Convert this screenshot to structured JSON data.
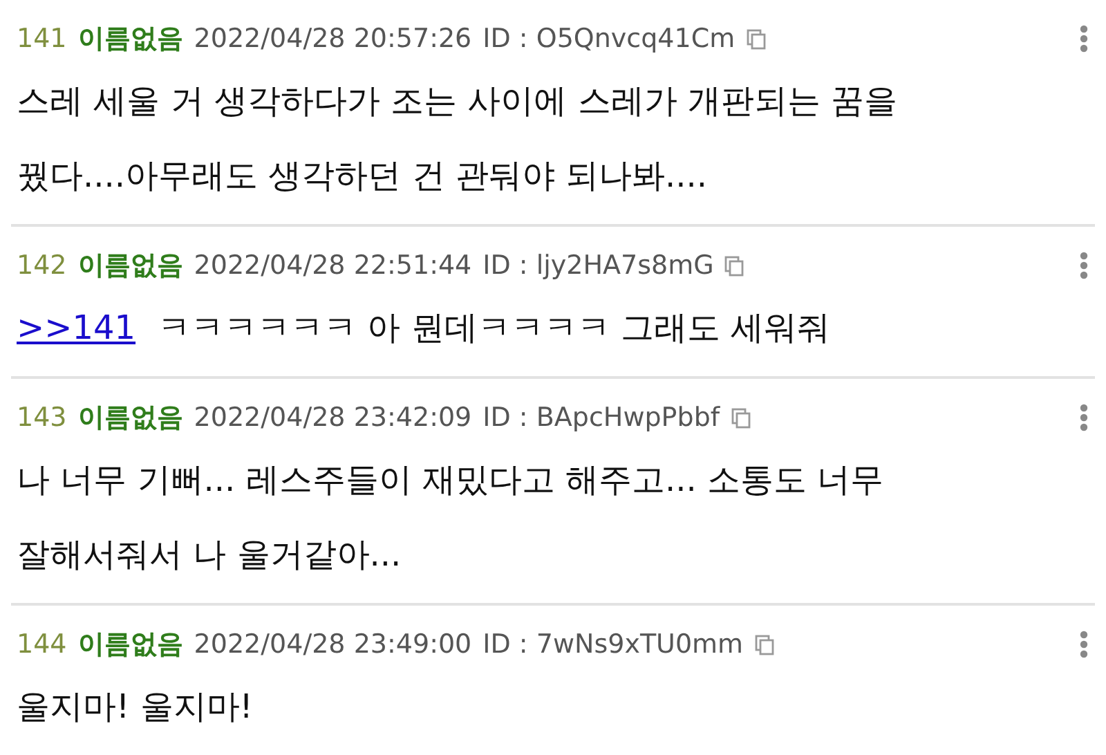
{
  "posts": [
    {
      "number": "141",
      "name": "이름없음",
      "datetime": "2022/04/28 20:57:26",
      "id": "ID : O5Qnvcq41Cm",
      "lines": [
        "스레 세울 거 생각하다가 조는 사이에 스레가 개판되는 꿈을",
        "꿨다....아무래도 생각하던 건 관둬야 되나봐...."
      ]
    },
    {
      "number": "142",
      "name": "이름없음",
      "datetime": "2022/04/28 22:51:44",
      "id": "ID : ljy2HA7s8mG",
      "reply_link": ">>141",
      "lines": [
        "ㅋㅋㅋㅋㅋㅋ 아 뭔데ㅋㅋㅋㅋ 그래도 세워줘"
      ]
    },
    {
      "number": "143",
      "name": "이름없음",
      "datetime": "2022/04/28 23:42:09",
      "id": "ID : BApcHwpPbbf",
      "lines": [
        "나 너무 기뻐... 레스주들이 재밌다고 해주고... 소통도 너무",
        "잘해서줘서 나 울거같아..."
      ]
    },
    {
      "number": "144",
      "name": "이름없음",
      "datetime": "2022/04/28 23:49:00",
      "id": "ID : 7wNs9xTU0mm",
      "lines": [
        "울지마! 울지마!"
      ]
    }
  ]
}
